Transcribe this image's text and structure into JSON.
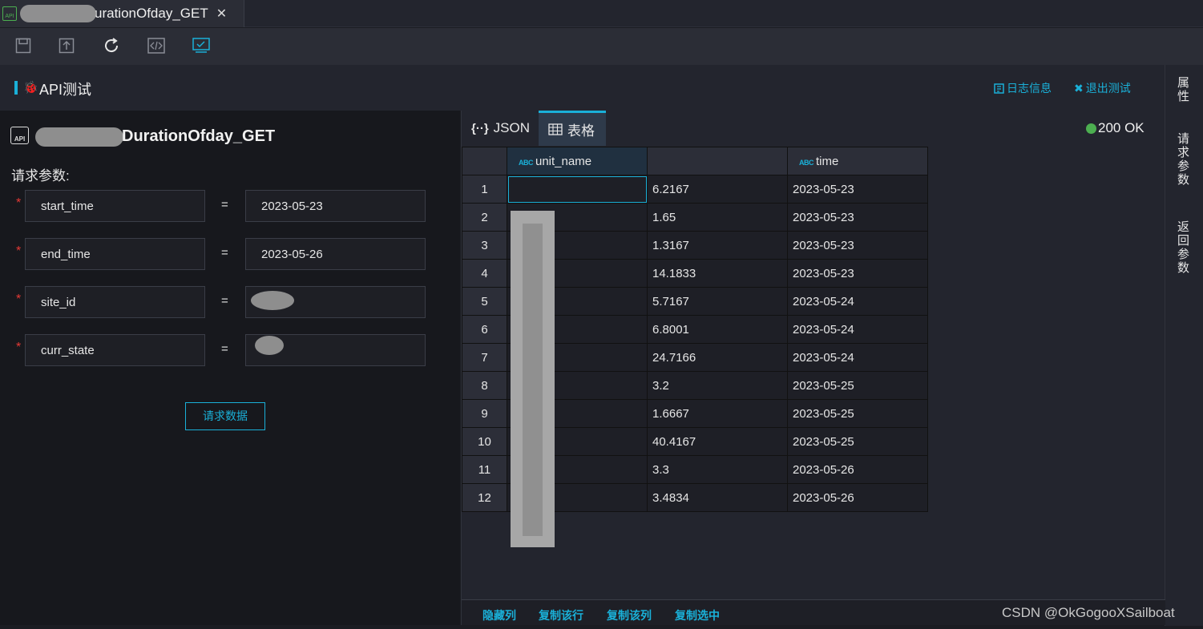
{
  "tab": {
    "title": "urationOfday_GET",
    "close": "✕"
  },
  "toolbar": {
    "icons": [
      "save-icon",
      "upload-icon",
      "refresh-icon",
      "code-icon",
      "monitor-icon"
    ]
  },
  "header": {
    "title": "API测试",
    "log_link": "日志信息",
    "exit_link": "退出测试"
  },
  "right_strip": {
    "props": "属性",
    "req_params": "请求参数",
    "ret_params": "返回参数"
  },
  "left": {
    "api_name": "DurationOfday_GET",
    "req_label": "请求参数:",
    "params": [
      {
        "name": "start_time",
        "value": "2023-05-23"
      },
      {
        "name": "end_time",
        "value": "2023-05-26"
      },
      {
        "name": "site_id",
        "value": ""
      },
      {
        "name": "curr_state",
        "value": ""
      }
    ],
    "submit": "请求数据"
  },
  "result": {
    "tab_json": "JSON",
    "tab_table": "表格",
    "status": "200 OK",
    "columns": [
      "unit_name",
      "",
      "time"
    ],
    "abc": "ABC",
    "rows": [
      {
        "n": "1",
        "v": "6.2167",
        "t": "2023-05-23"
      },
      {
        "n": "2",
        "v": "1.65",
        "t": "2023-05-23"
      },
      {
        "n": "3",
        "v": "1.3167",
        "t": "2023-05-23"
      },
      {
        "n": "4",
        "v": "14.1833",
        "t": "2023-05-23"
      },
      {
        "n": "5",
        "v": "5.7167",
        "t": "2023-05-24"
      },
      {
        "n": "6",
        "v": "6.8001",
        "t": "2023-05-24"
      },
      {
        "n": "7",
        "v": "24.7166",
        "t": "2023-05-24"
      },
      {
        "n": "8",
        "v": "3.2",
        "t": "2023-05-25"
      },
      {
        "n": "9",
        "v": "1.6667",
        "t": "2023-05-25"
      },
      {
        "n": "10",
        "v": "40.4167",
        "t": "2023-05-25"
      },
      {
        "n": "11",
        "v": "3.3",
        "t": "2023-05-26"
      },
      {
        "n": "12",
        "v": "3.4834",
        "t": "2023-05-26"
      }
    ],
    "bottom": {
      "hide_col": "隐藏列",
      "copy_row": "复制该行",
      "copy_col": "复制该列",
      "copy_sel": "复制选中"
    }
  },
  "watermark": "CSDN @OkGogooXSailboat"
}
